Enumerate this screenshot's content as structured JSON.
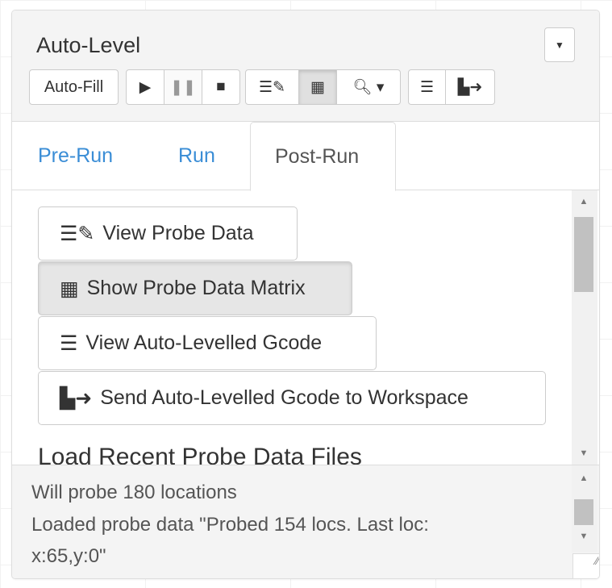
{
  "header": {
    "title": "Auto-Level",
    "menu_icon": "caret-down-icon"
  },
  "toolbar": {
    "auto_fill": "Auto-Fill"
  },
  "tabs": [
    {
      "label": "Pre-Run"
    },
    {
      "label": "Run"
    },
    {
      "label": "Post-Run"
    }
  ],
  "post_run": {
    "buttons": [
      {
        "label": "View Probe Data"
      },
      {
        "label": "Show Probe Data Matrix"
      },
      {
        "label": "View Auto-Levelled Gcode"
      },
      {
        "label": "Send Auto-Levelled Gcode to Workspace"
      }
    ],
    "heading": "Load Recent Probe Data Files"
  },
  "log": {
    "lines": [
      "Will probe 180 locations",
      "Loaded probe data \"Probed 154 locs. Last loc:",
      "x:65,y:0\""
    ]
  },
  "colors": {
    "tab_link": "#3a8dd6",
    "header_bg": "#f4f4f4"
  }
}
